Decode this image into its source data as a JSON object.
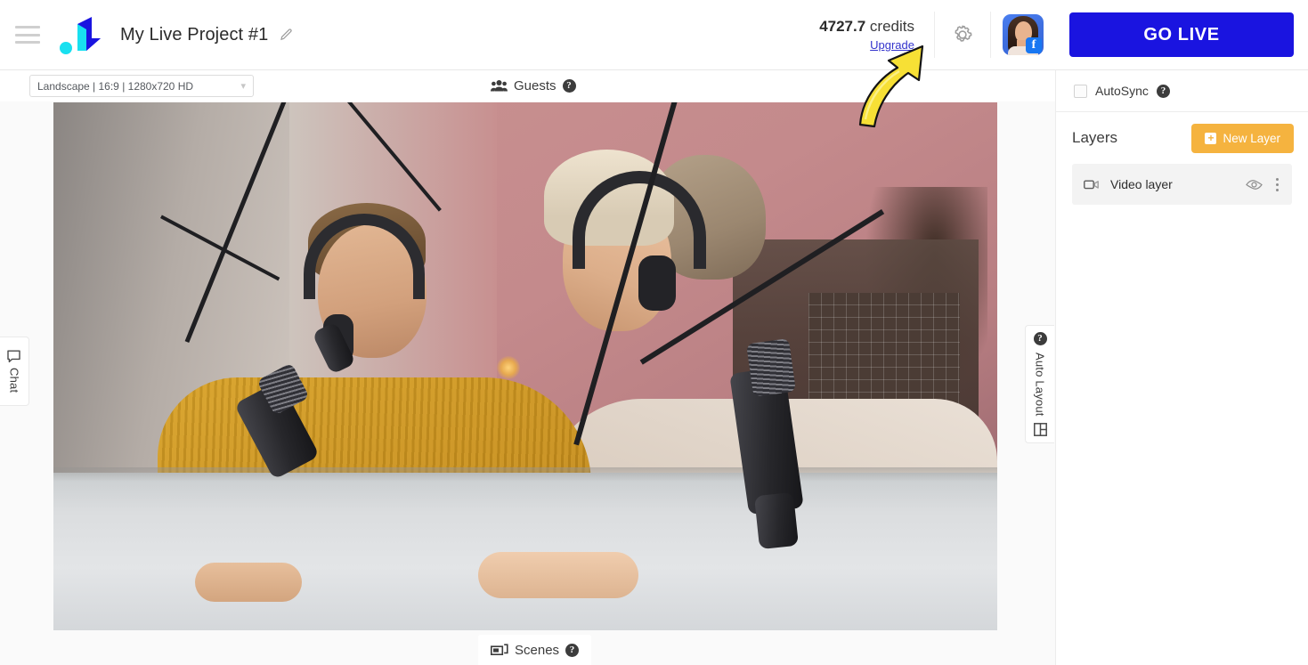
{
  "header": {
    "menu_icon": "hamburger-menu-icon",
    "logo_icon": "restream-logo-icon",
    "project_title": "My Live Project #1",
    "edit_icon": "pencil-edit-icon",
    "credits_value": "4727.7",
    "credits_label": "credits",
    "upgrade_label": "Upgrade",
    "settings_icon": "gear-icon",
    "avatar_icon": "user-avatar",
    "avatar_badge": "facebook-badge",
    "facebook_letter": "f"
  },
  "golive": {
    "label": "GO LIVE",
    "accent_color": "#1a14e0"
  },
  "toolbar": {
    "ratio_value": "Landscape | 16:9 | 1280x720 HD",
    "chevron_icon": "chevron-down-icon",
    "guests_label": "Guests",
    "guests_icon": "people-icon",
    "scenes_label": "Scenes",
    "scenes_icon": "screen-icon",
    "help_icon": "help-circle-icon"
  },
  "side_tabs": {
    "chat_label": "Chat",
    "chat_icon": "chat-bubble-icon",
    "auto_layout_label": "Auto Layout",
    "auto_layout_icon": "layout-grid-icon",
    "help_icon": "help-circle-icon"
  },
  "right_panel": {
    "autosync_label": "AutoSync",
    "autosync_checked": false,
    "layers_title": "Layers",
    "new_layer_label": "New Layer",
    "new_layer_color": "#f5b33f",
    "plus_glyph": "+",
    "layers": [
      {
        "name": "Video layer",
        "type_icon": "video-camera-icon",
        "visibility_icon": "eye-icon",
        "menu_icon": "kebab-menu-icon"
      }
    ]
  },
  "annotation": {
    "arrow_icon": "yellow-curved-arrow",
    "arrow_color": "#f7e035",
    "points_to": "gear-icon"
  },
  "canvas": {
    "preview_description": "Two podcast hosts with headphones at a table with microphones"
  }
}
